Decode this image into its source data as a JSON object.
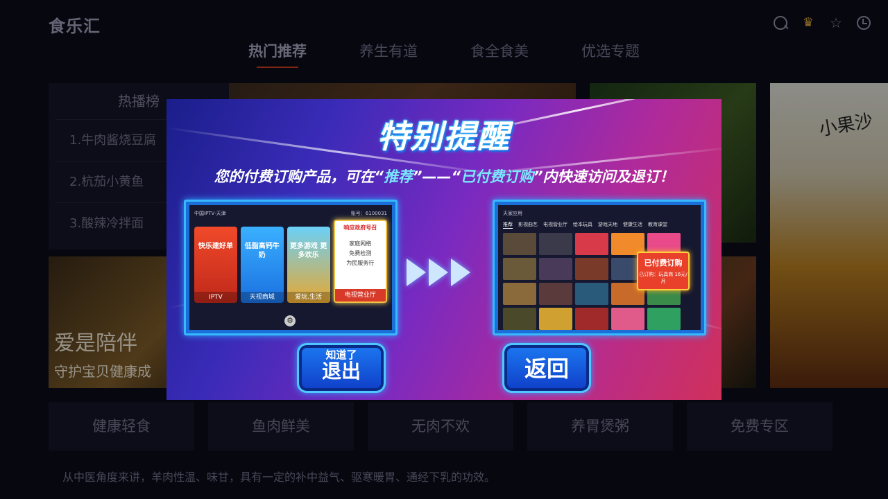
{
  "app": {
    "logo": "食乐汇"
  },
  "header": {
    "icons": [
      "search-icon",
      "crown-icon",
      "star-icon",
      "clock-icon"
    ],
    "tabs": [
      {
        "label": "热门推荐",
        "active": true
      },
      {
        "label": "养生有道"
      },
      {
        "label": "食全食美"
      },
      {
        "label": "优选专题"
      }
    ]
  },
  "hot_list": {
    "title": "热播榜",
    "items": [
      "1.牛肉酱烧豆腐",
      "2.杭茄小黄鱼",
      "3.酸辣冷拌面"
    ]
  },
  "tiles": {
    "side_brush_text": "小果沙",
    "slogan_line1": "爱是陪伴",
    "slogan_line2": "守护宝贝健康成"
  },
  "categories": [
    "健康轻食",
    "鱼肉鲜美",
    "无肉不欢",
    "养胃煲粥",
    "免费专区"
  ],
  "footer_text": "从中医角度来讲，羊肉性温、味甘，具有一定的补中益气、驱寒暖胃、通经下乳的功效。",
  "modal": {
    "title": "特别提醒",
    "subtitle_part1": "您的付费订购产品，可在“",
    "subtitle_hl1": "推荐",
    "subtitle_part2": "”——“",
    "subtitle_hl2": "已付费订购",
    "subtitle_part3": "”内快速访问及退订！",
    "left_screen": {
      "header_left": "中国IPTV·天津",
      "header_right": "账号：6100031",
      "cards": [
        {
          "label": "IPTV",
          "big": "快乐建好单"
        },
        {
          "label": "天视商城",
          "big": "低脂高钙牛奶"
        },
        {
          "label": "爱玩.生活",
          "big": "更多游戏 更多欢乐"
        },
        {
          "label": "电视营业厅",
          "brand": "响应政府号召",
          "lines": [
            "家庭网络",
            "免费检测",
            "为民服务行"
          ]
        }
      ]
    },
    "right_screen": {
      "header_left": "天家应用",
      "tabs": [
        "推荐",
        "影视曲艺",
        "电视营业厅",
        "绘本玩具",
        "游戏天地",
        "健康生活",
        "教育课堂"
      ],
      "paid_badge": "已付费订购",
      "paid_detail": "已订购：玩具商 16元/月"
    },
    "buttons": {
      "exit_small": "知道了",
      "exit_large": "退出",
      "back": "返回"
    },
    "colors": {
      "accent": "#38b8ff",
      "highlight": "#7ae8ff"
    }
  }
}
